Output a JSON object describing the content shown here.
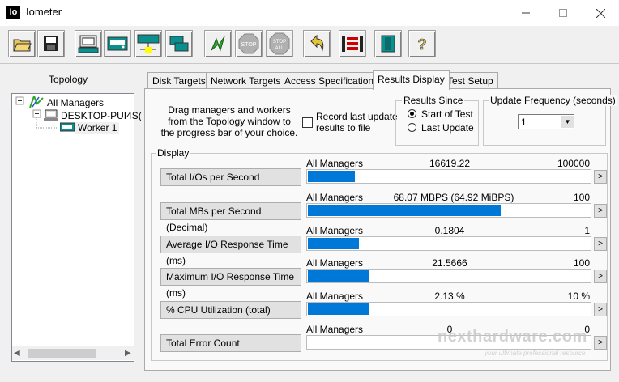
{
  "window": {
    "title": "Iometer",
    "icon_text": "Io"
  },
  "toolbar": {
    "buttons": [
      "open-icon",
      "save-icon",
      "start-display-icon",
      "new-disk-worker-icon",
      "new-network-worker-icon",
      "duplicate-worker-icon",
      "start-tests-icon",
      "stop-icon",
      "stop-all-icon",
      "reset-workers-icon",
      "disconnect-managers-icon",
      "exit-icon",
      "about-icon"
    ],
    "stop_label": "STOP",
    "stop_all_label": "STOP ALL"
  },
  "topology": {
    "title": "Topology",
    "tree": [
      "All Managers",
      "DESKTOP-PUI4S(",
      "Worker 1"
    ]
  },
  "tabs": [
    "Disk Targets",
    "Network Targets",
    "Access Specifications",
    "Results Display",
    "Test Setup"
  ],
  "instructions": "Drag managers and workers from the Topology window to the progress bar of your choice.",
  "record": {
    "label": "Record last update results to file"
  },
  "results_since": {
    "title": "Results Since",
    "options": [
      "Start of Test",
      "Last Update"
    ],
    "selected": "Start of Test"
  },
  "update_frequency": {
    "title": "Update Frequency (seconds)",
    "value": "1"
  },
  "display": {
    "title": "Display",
    "rows": [
      {
        "button": "Total I/Os per Second",
        "manager": "All Managers",
        "value": "16619.22",
        "max": "100000",
        "fill": 0.166
      },
      {
        "button": "Total MBs per Second (Decimal)",
        "manager": "All Managers",
        "value": "68.07 MBPS (64.92 MiBPS)",
        "max": "100",
        "fill": 0.68
      },
      {
        "button": "Average I/O Response Time (ms)",
        "manager": "All Managers",
        "value": "0.1804",
        "max": "1",
        "fill": 0.18
      },
      {
        "button": "Maximum I/O Response Time (ms)",
        "manager": "All Managers",
        "value": "21.5666",
        "max": "100",
        "fill": 0.216
      },
      {
        "button": "% CPU Utilization (total)",
        "manager": "All Managers",
        "value": "2.13 %",
        "max": "10 %",
        "fill": 0.213
      },
      {
        "button": "Total Error Count",
        "manager": "All Managers",
        "value": "0",
        "max": "0",
        "fill": 0
      }
    ]
  },
  "watermark": {
    "text": "nexthardware.com",
    "tagline": "your ultimate professional resource"
  },
  "colors": {
    "accent": "#0078d7",
    "panel": "#f9f9f9",
    "window": "#f0f0f0"
  }
}
